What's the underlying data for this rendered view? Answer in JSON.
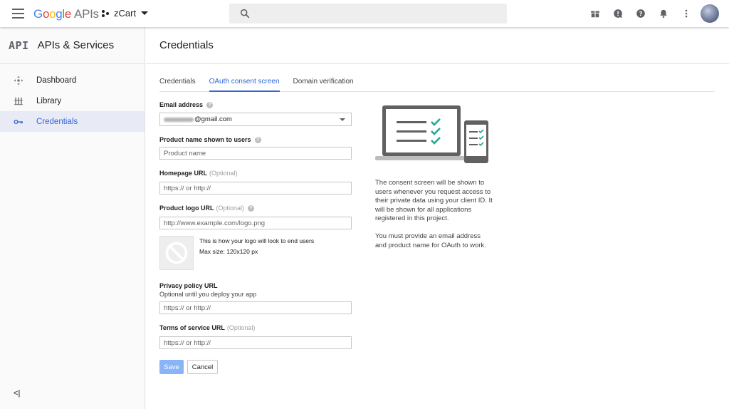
{
  "topbar": {
    "logo": {
      "g": "G",
      "o1": "o",
      "o2": "o",
      "g2": "g",
      "l": "l",
      "e": "e",
      "apis": "APIs"
    },
    "project_name": "zCart",
    "search_placeholder": ""
  },
  "sidebar": {
    "mark": "API",
    "title": "APIs & Services",
    "items": [
      {
        "label": "Dashboard",
        "icon": "dashboard-icon"
      },
      {
        "label": "Library",
        "icon": "library-icon"
      },
      {
        "label": "Credentials",
        "icon": "key-icon",
        "active": true
      }
    ],
    "collapse_label": "<|"
  },
  "page": {
    "title": "Credentials",
    "tabs": [
      {
        "label": "Credentials"
      },
      {
        "label": "OAuth consent screen",
        "active": true
      },
      {
        "label": "Domain verification"
      }
    ]
  },
  "form": {
    "email": {
      "label": "Email address",
      "value": "@gmail.com"
    },
    "product_name": {
      "label": "Product name shown to users",
      "placeholder": "Product name"
    },
    "homepage": {
      "label": "Homepage URL",
      "optional": "(Optional)",
      "placeholder": "https:// or http://"
    },
    "logo_url": {
      "label": "Product logo URL",
      "optional": "(Optional)",
      "placeholder": "http://www.example.com/logo.png"
    },
    "logo_preview": {
      "line1": "This is how your logo will look to end users",
      "line2": "Max size: 120x120 px"
    },
    "privacy": {
      "label": "Privacy policy URL",
      "subtext": "Optional until you deploy your app",
      "placeholder": "https:// or http://"
    },
    "tos": {
      "label": "Terms of service URL",
      "optional": "(Optional)",
      "placeholder": "https:// or http://"
    },
    "save_label": "Save",
    "cancel_label": "Cancel"
  },
  "info": {
    "p1": "The consent screen will be shown to users whenever you request access to their private data using your client ID. It will be shown for all applications registered in this project.",
    "p2": "You must provide an email address and product name for OAuth to work."
  },
  "colors": {
    "accent": "#3367d6",
    "check": "#26a69a",
    "save_disabled": "#8ab4f8"
  }
}
